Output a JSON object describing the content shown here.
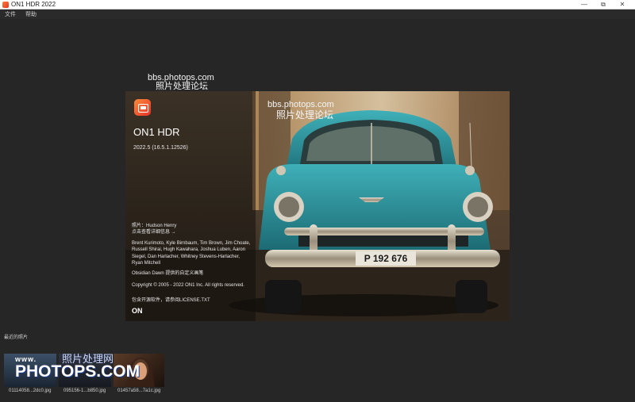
{
  "window": {
    "title": "ON1 HDR 2022",
    "controls": {
      "minimize": "—",
      "maximize": "⧉",
      "close": "✕"
    }
  },
  "menu": {
    "items": [
      {
        "label": "文件"
      },
      {
        "label": "帮助"
      }
    ]
  },
  "watermarks": {
    "top": {
      "line1": "bbs.photops.com",
      "line2": "照片处理论坛"
    },
    "center": {
      "line1": "bbs.photops.com",
      "line2": "照片处理论坛"
    },
    "thumbs": {
      "cn": "照片处理网",
      "www": "www.",
      "big": "PHOTOPS.COM"
    }
  },
  "splash": {
    "product_name": "ON1 HDR",
    "version": "2022.5 (16.5.1.12526)",
    "photo_credit": "照片：Hudson Henry",
    "credit_link": "点击查看详细信息 →",
    "contributors": "Brent Kurimoto, Kyle Birnbaum, Tim Brown, Jim Choate, Russell Shirai, Hugh Kawahara, Joshua Luben, Aaron Siegel, Dan Harlacher, Whitney Stevens-Harlacher, Ryan Mitchell",
    "obsidian": "Obsidian Dawn 提供的自定义画笔",
    "copyright": "Copyright © 2005 - 2022 ON1 Inc. All rights reserved.",
    "license": "包含开源软件，请参阅LICENSE.TXT",
    "brand_mark": "ON",
    "plate": "P 192 676",
    "logo_icon": "on1-hdr-logo-icon"
  },
  "recent": {
    "label": "最近的照片",
    "thumbnails": [
      {
        "caption": "01114058...2dc0.jpg"
      },
      {
        "caption": "095156-1...b850.jpg"
      },
      {
        "caption": "01457a58...7a1c.jpg"
      }
    ]
  },
  "colors": {
    "background": "#262626",
    "titlebar": "#ffffff",
    "car_body": "#2a8f9a",
    "accent_logo": "#e8502c"
  }
}
